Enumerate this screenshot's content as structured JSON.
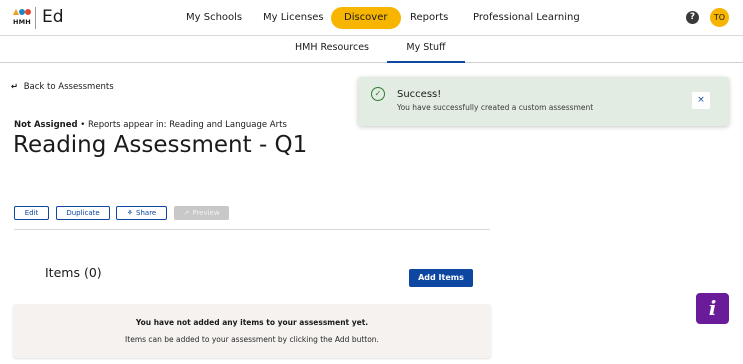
{
  "brand": {
    "hmh": "HMH",
    "product": "Ed",
    "mark_colors": [
      "#f29b1d",
      "#1e88c7",
      "#e8442e"
    ]
  },
  "nav": {
    "items": [
      {
        "label": "My Schools"
      },
      {
        "label": "My Licenses"
      },
      {
        "label": "Discover",
        "active": true
      },
      {
        "label": "Reports"
      },
      {
        "label": "Professional Learning"
      }
    ],
    "help_icon": "?",
    "avatar_initials": "TO"
  },
  "subnav": {
    "tabs": [
      {
        "label": "HMH Resources"
      },
      {
        "label": "My Stuff",
        "selected": true
      }
    ]
  },
  "back_link": {
    "icon": "back-arrow-icon",
    "label": "Back to Assessments"
  },
  "assessment": {
    "status": "Not Assigned",
    "reports_note": " • Reports appear in: Reading and Language Arts",
    "title": "Reading Assessment - Q1"
  },
  "actions": {
    "edit": "Edit",
    "duplicate": "Duplicate",
    "share": "Share",
    "preview": "Preview"
  },
  "items": {
    "heading": "Items (0)",
    "add_button": "Add Items",
    "empty_title": "You have not added any items to your assessment yet.",
    "empty_body": "Items can be added to your assessment by clicking the Add button."
  },
  "toast": {
    "title": "Success!",
    "message": "You have successfully created a custom assessment",
    "close_icon": "×"
  },
  "info_widget": {
    "label": "i"
  },
  "colors": {
    "accent_blue": "#0d47a1",
    "active_nav": "#f7b500",
    "toast_bg": "#e3ece2",
    "success_green": "#2e7d32",
    "info_purple": "#6a1b9a"
  }
}
